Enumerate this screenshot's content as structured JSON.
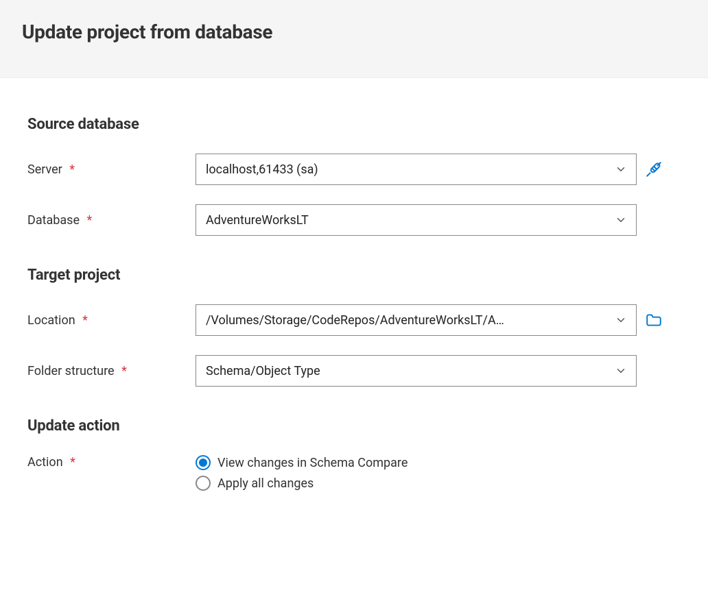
{
  "header": {
    "title": "Update project from database"
  },
  "sections": {
    "source_db": {
      "heading": "Source database",
      "server_label": "Server",
      "server_value": "localhost,61433 (sa)",
      "database_label": "Database",
      "database_value": "AdventureWorksLT"
    },
    "target_project": {
      "heading": "Target project",
      "location_label": "Location",
      "location_value": "/Volumes/Storage/CodeRepos/AdventureWorksLT/A…",
      "folder_label": "Folder structure",
      "folder_value": "Schema/Object Type"
    },
    "update_action": {
      "heading": "Update action",
      "action_label": "Action",
      "options": {
        "view_changes": "View changes in Schema Compare",
        "apply_all": "Apply all changes"
      },
      "selected": "view_changes"
    }
  },
  "colors": {
    "accent": "#0078d4",
    "required": "#d9363e"
  }
}
